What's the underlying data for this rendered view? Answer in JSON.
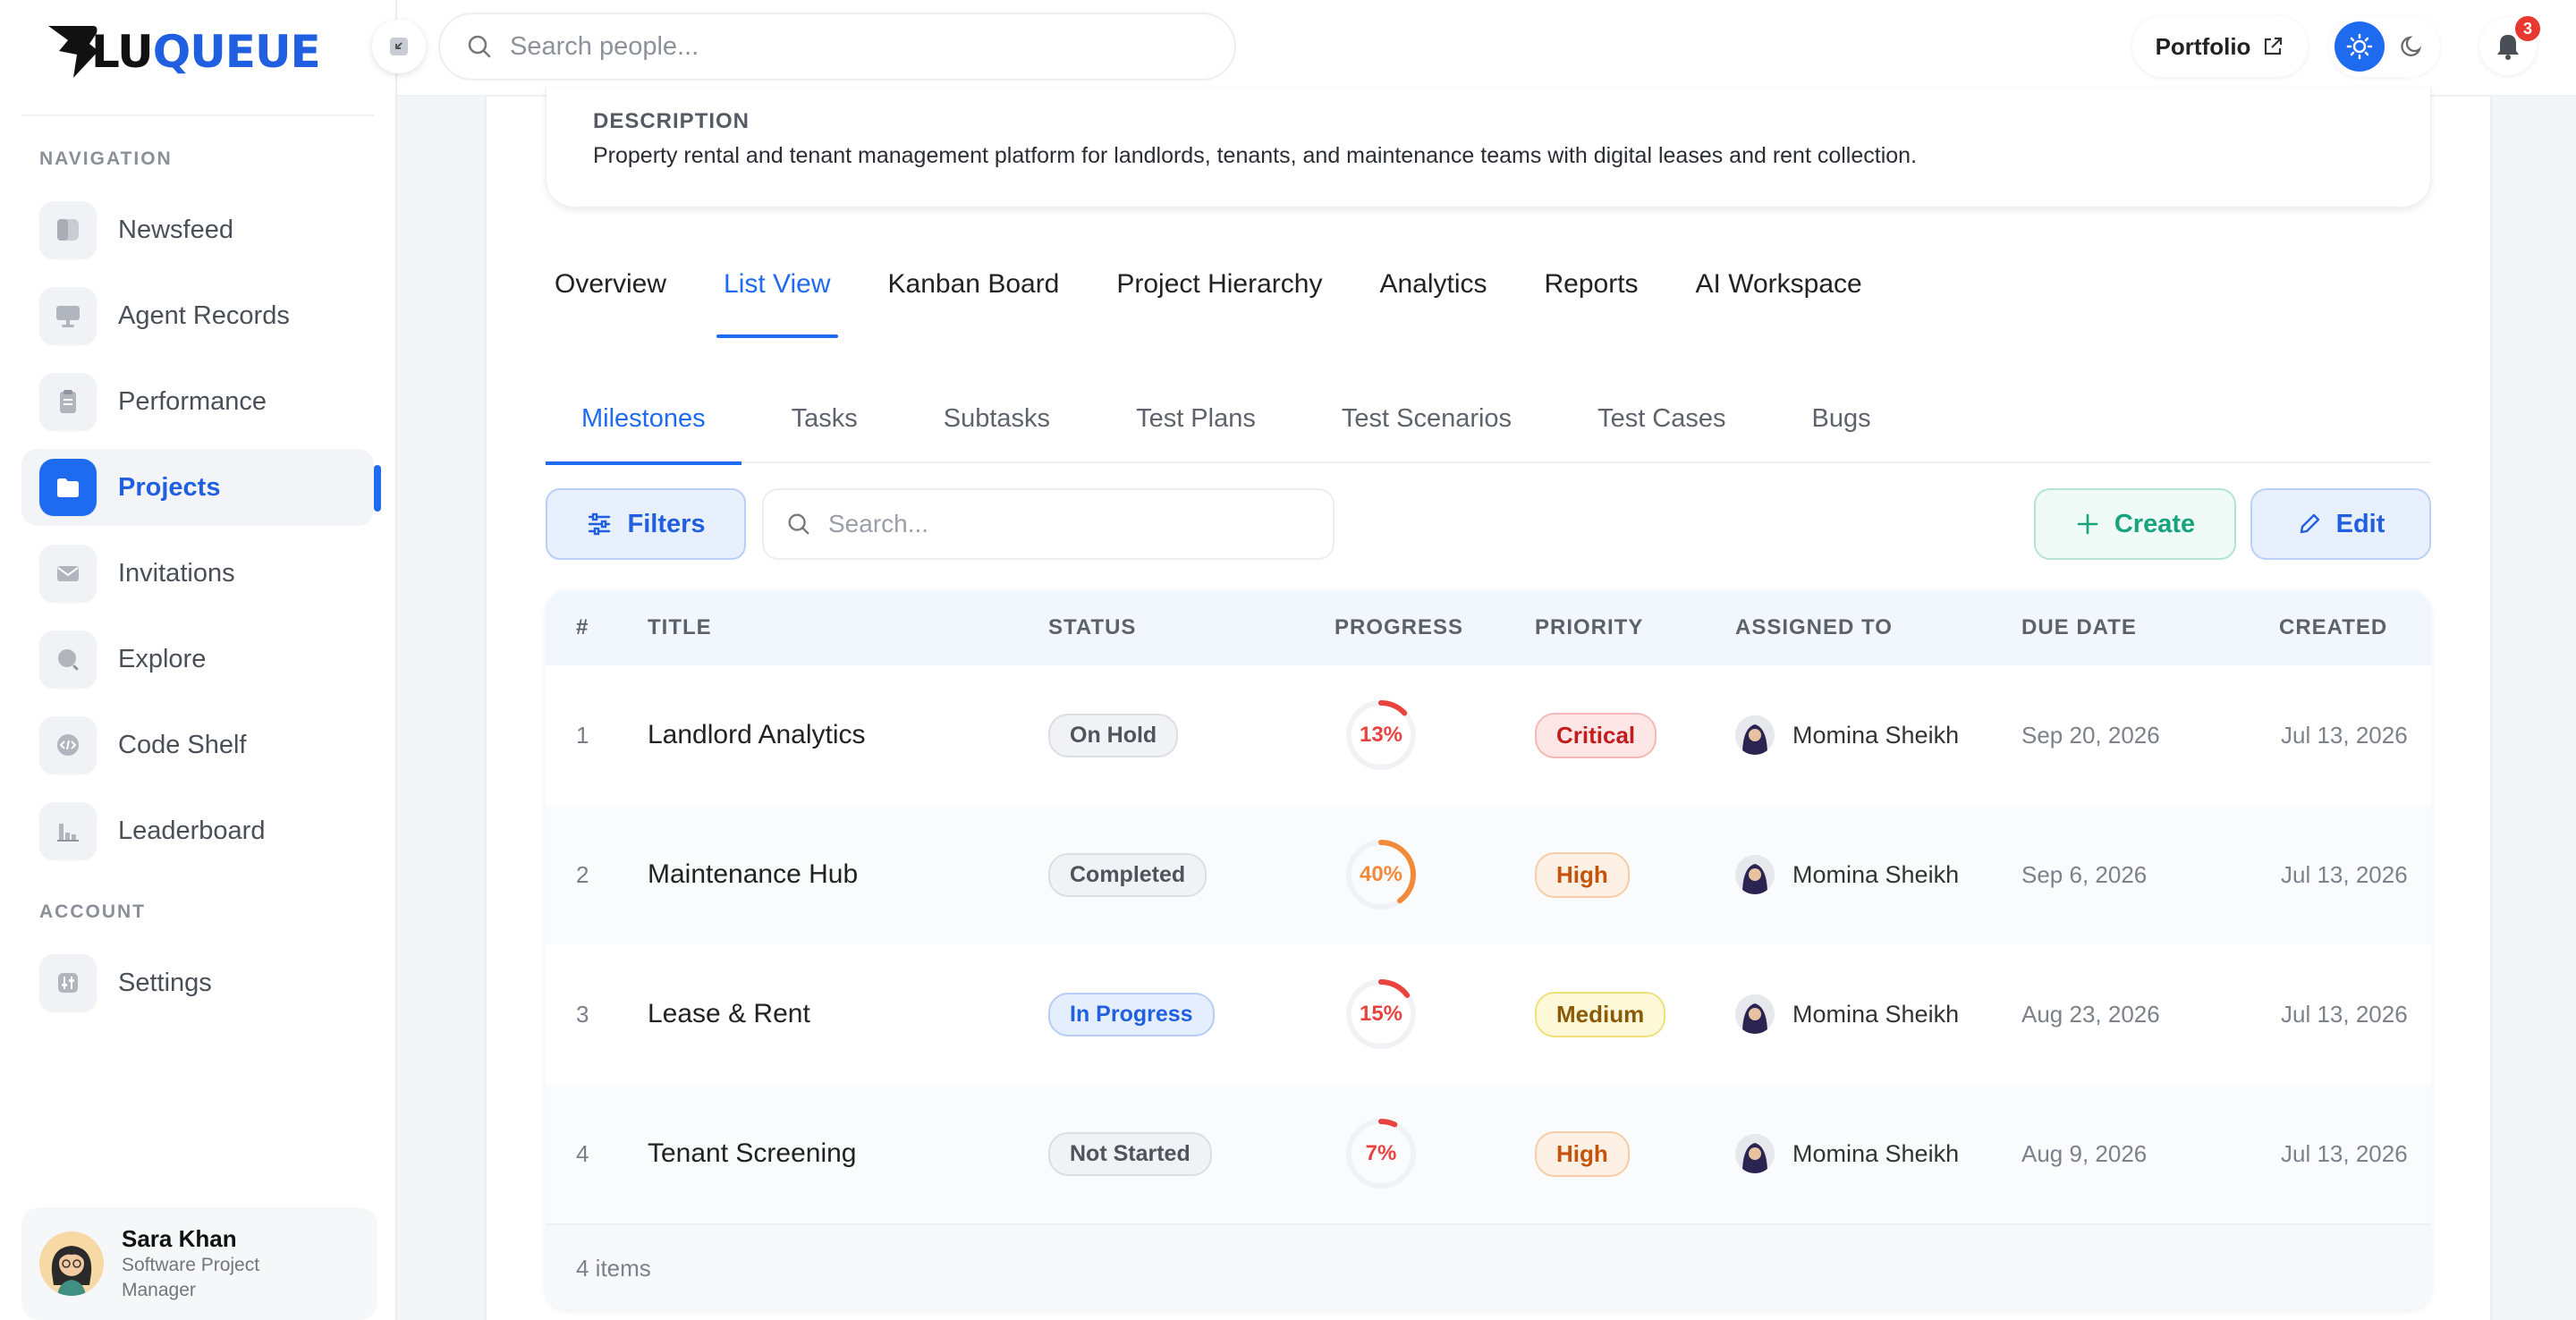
{
  "brand": {
    "name_part1": "LU",
    "name_part2": "QUEUE",
    "accent": "#1f6bf0"
  },
  "search": {
    "placeholder": "Search people..."
  },
  "header": {
    "portfolio_label": "Portfolio",
    "notifications_count": "3"
  },
  "sidebar": {
    "nav_section": "NAVIGATION",
    "account_section": "ACCOUNT",
    "items": [
      {
        "label": "Newsfeed",
        "icon": "newsfeed-icon"
      },
      {
        "label": "Agent Records",
        "icon": "monitor-icon"
      },
      {
        "label": "Performance",
        "icon": "clipboard-icon"
      },
      {
        "label": "Projects",
        "icon": "folder-icon",
        "active": true
      },
      {
        "label": "Invitations",
        "icon": "mail-icon"
      },
      {
        "label": "Explore",
        "icon": "search-icon"
      },
      {
        "label": "Code Shelf",
        "icon": "code-icon"
      },
      {
        "label": "Leaderboard",
        "icon": "bar-chart-icon"
      }
    ],
    "account_items": [
      {
        "label": "Settings",
        "icon": "sliders-icon"
      }
    ],
    "profile": {
      "name": "Sara Khan",
      "role": "Software Project Manager"
    }
  },
  "project": {
    "description_label": "DESCRIPTION",
    "description": "Property rental and tenant management platform for landlords, tenants, and maintenance teams with digital leases and rent collection."
  },
  "tabs": [
    "Overview",
    "List View",
    "Kanban Board",
    "Project Hierarchy",
    "Analytics",
    "Reports",
    "AI Workspace"
  ],
  "active_tab": "List View",
  "subtabs": [
    "Milestones",
    "Tasks",
    "Subtasks",
    "Test Plans",
    "Test Scenarios",
    "Test Cases",
    "Bugs"
  ],
  "active_subtab": "Milestones",
  "toolbar": {
    "filters_label": "Filters",
    "search_placeholder": "Search...",
    "create_label": "Create",
    "edit_label": "Edit"
  },
  "table": {
    "columns": [
      "#",
      "TITLE",
      "STATUS",
      "PROGRESS",
      "PRIORITY",
      "ASSIGNED TO",
      "DUE DATE",
      "CREATED"
    ],
    "rows": [
      {
        "num": "1",
        "title": "Landlord Analytics",
        "status": "On Hold",
        "progress": "13%",
        "progress_value": 13,
        "progress_color": "#e8433f",
        "priority": "Critical",
        "assignee": "Momina Sheikh",
        "due": "Sep 20, 2026",
        "created": "Jul 13, 2026"
      },
      {
        "num": "2",
        "title": "Maintenance Hub",
        "status": "Completed",
        "progress": "40%",
        "progress_value": 40,
        "progress_color": "#f38a3a",
        "priority": "High",
        "assignee": "Momina Sheikh",
        "due": "Sep 6, 2026",
        "created": "Jul 13, 2026"
      },
      {
        "num": "3",
        "title": "Lease & Rent",
        "status": "In Progress",
        "progress": "15%",
        "progress_value": 15,
        "progress_color": "#e8433f",
        "priority": "Medium",
        "assignee": "Momina Sheikh",
        "due": "Aug 23, 2026",
        "created": "Jul 13, 2026"
      },
      {
        "num": "4",
        "title": "Tenant Screening",
        "status": "Not Started",
        "progress": "7%",
        "progress_value": 7,
        "progress_color": "#e8433f",
        "priority": "High",
        "assignee": "Momina Sheikh",
        "due": "Aug 9, 2026",
        "created": "Jul 13, 2026"
      }
    ],
    "footer": "4 items"
  }
}
